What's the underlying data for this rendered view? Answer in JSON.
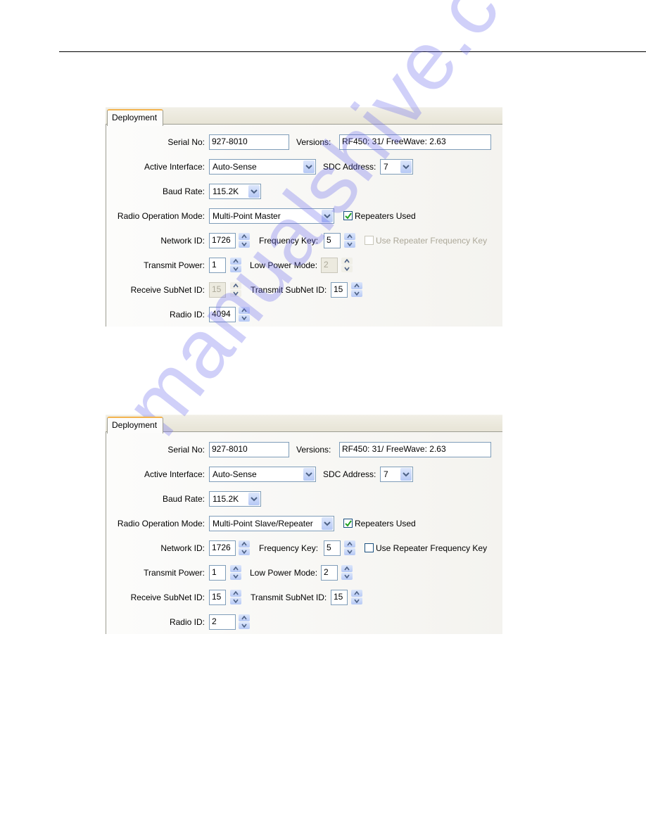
{
  "watermark": "manualshive.com",
  "panels": [
    {
      "tab": "Deployment",
      "serial_no": {
        "label": "Serial No:",
        "value": "927-8010"
      },
      "versions": {
        "label": "Versions:",
        "value": "RF450: 31/ FreeWave: 2.63"
      },
      "active_interface": {
        "label": "Active Interface:",
        "value": "Auto-Sense"
      },
      "sdc_address": {
        "label": "SDC Address:",
        "value": "7"
      },
      "baud_rate": {
        "label": "Baud Rate:",
        "value": "115.2K"
      },
      "radio_operation_mode": {
        "label": "Radio Operation Mode:",
        "value": "Multi-Point Master"
      },
      "repeaters_used": {
        "label": "Repeaters Used",
        "checked": true,
        "enabled": true
      },
      "network_id": {
        "label": "Network ID:",
        "value": "1726"
      },
      "frequency_key": {
        "label": "Frequency Key:",
        "value": "5"
      },
      "use_repeater_frequency_key": {
        "label": "Use Repeater Frequency Key",
        "checked": false,
        "enabled": false
      },
      "transmit_power": {
        "label": "Transmit Power:",
        "value": "1"
      },
      "low_power_mode": {
        "label": "Low Power Mode:",
        "value": "2",
        "enabled": false
      },
      "receive_subnet_id": {
        "label": "Receive SubNet ID:",
        "value": "15",
        "enabled": false
      },
      "transmit_subnet_id": {
        "label": "Transmit SubNet ID:",
        "value": "15"
      },
      "radio_id": {
        "label": "Radio ID:",
        "value": "4094"
      }
    },
    {
      "tab": "Deployment",
      "serial_no": {
        "label": "Serial No:",
        "value": "927-8010"
      },
      "versions": {
        "label": "Versions:",
        "value": "RF450: 31/ FreeWave: 2.63"
      },
      "active_interface": {
        "label": "Active Interface:",
        "value": "Auto-Sense"
      },
      "sdc_address": {
        "label": "SDC Address:",
        "value": "7"
      },
      "baud_rate": {
        "label": "Baud Rate:",
        "value": "115.2K"
      },
      "radio_operation_mode": {
        "label": "Radio Operation Mode:",
        "value": "Multi-Point Slave/Repeater"
      },
      "repeaters_used": {
        "label": "Repeaters Used",
        "checked": true,
        "enabled": true
      },
      "network_id": {
        "label": "Network ID:",
        "value": "1726"
      },
      "frequency_key": {
        "label": "Frequency Key:",
        "value": "5"
      },
      "use_repeater_frequency_key": {
        "label": "Use Repeater Frequency Key",
        "checked": false,
        "enabled": true
      },
      "transmit_power": {
        "label": "Transmit Power:",
        "value": "1"
      },
      "low_power_mode": {
        "label": "Low Power Mode:",
        "value": "2",
        "enabled": true
      },
      "receive_subnet_id": {
        "label": "Receive SubNet ID:",
        "value": "15",
        "enabled": true
      },
      "transmit_subnet_id": {
        "label": "Transmit SubNet ID:",
        "value": "15"
      },
      "radio_id": {
        "label": "Radio ID:",
        "value": "2"
      }
    }
  ]
}
